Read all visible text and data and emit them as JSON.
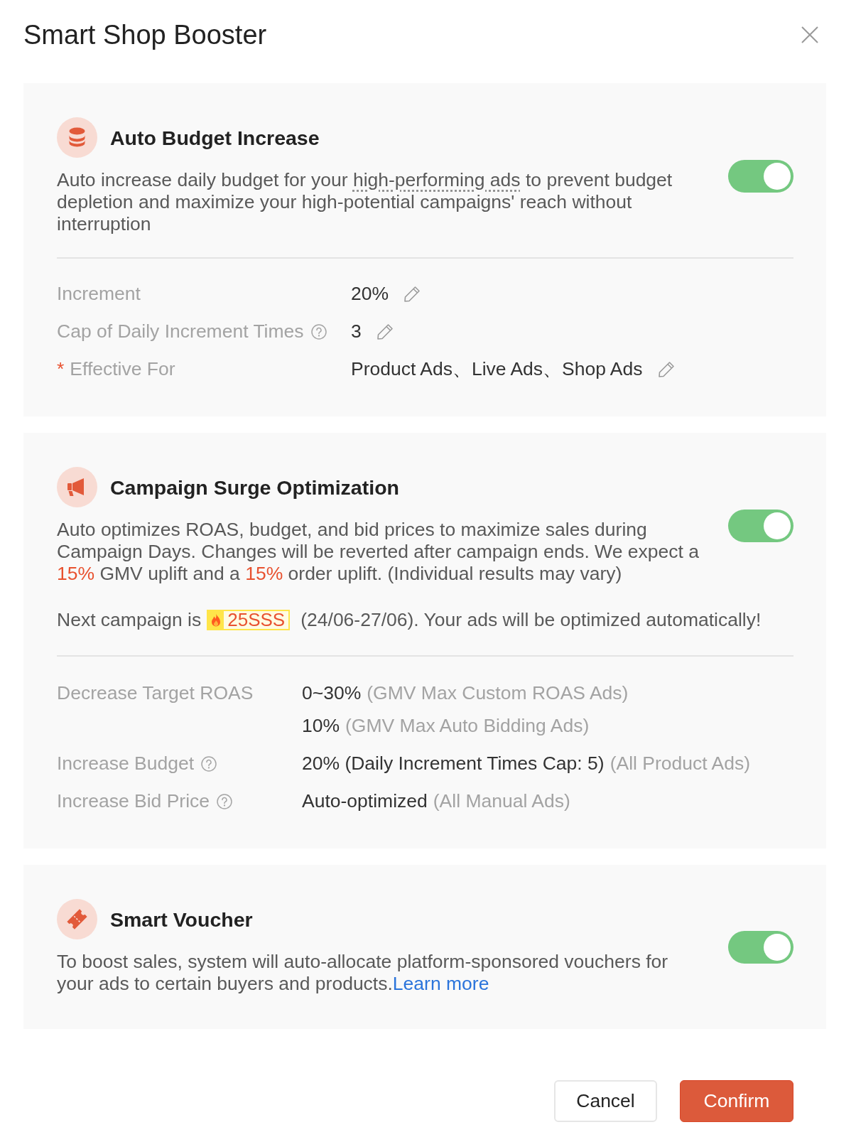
{
  "dialog": {
    "title": "Smart Shop Booster"
  },
  "sections": [
    {
      "title": "Auto Budget Increase",
      "enabled": true,
      "description": [
        {
          "kind": "text",
          "text": "Auto increase daily budget for your "
        },
        {
          "kind": "term",
          "text": "high-performing ads"
        },
        {
          "kind": "text",
          "text": " to prevent budget depletion and maximize your high-potential campaigns' reach without interruption"
        }
      ],
      "settings": [
        {
          "label": "Increment",
          "help": false,
          "editable": true,
          "values": [
            {
              "value": "20%"
            }
          ]
        },
        {
          "label": "Cap of Daily Increment Times",
          "help": true,
          "editable": true,
          "values": [
            {
              "value": "3"
            }
          ]
        },
        {
          "marker": "*",
          "label": "Effective For",
          "help": false,
          "editable": true,
          "values": [
            {
              "value": "Product Ads、Live Ads、Shop Ads"
            }
          ]
        }
      ]
    },
    {
      "title": "Campaign Surge Optimization",
      "enabled": true,
      "description": [
        {
          "kind": "text",
          "text": "Auto optimizes ROAS, budget, and bid prices to maximize sales during Campaign Days. Changes will be reverted after campaign ends. We expect a "
        },
        {
          "kind": "highlight",
          "text": "15%"
        },
        {
          "kind": "text",
          "text": " GMV uplift and a "
        },
        {
          "kind": "highlight",
          "text": "15%"
        },
        {
          "kind": "text",
          "text": " order uplift. (Individual results may vary)"
        }
      ],
      "campaign": {
        "lead": "Next campaign is",
        "name": "25SSS",
        "detail": "(24/06-27/06). Your ads will be optimized automatically!"
      },
      "settings": [
        {
          "label": "Decrease Target ROAS",
          "help": false,
          "editable": false,
          "values": [
            {
              "value": "0~30%",
              "note": "(GMV Max Custom ROAS Ads)"
            },
            {
              "value": "10%",
              "note": "(GMV Max Auto Bidding Ads)"
            }
          ]
        },
        {
          "label": "Increase Budget",
          "help": true,
          "editable": false,
          "values": [
            {
              "value": "20% (Daily Increment Times Cap: 5)",
              "note": "(All Product Ads)"
            }
          ]
        },
        {
          "label": "Increase Bid Price",
          "help": true,
          "editable": false,
          "values": [
            {
              "value": "Auto-optimized",
              "note": "(All Manual Ads)"
            }
          ]
        }
      ]
    },
    {
      "title": "Smart Voucher",
      "enabled": true,
      "description": [
        {
          "kind": "text",
          "text": "To boost sales, system will auto-allocate platform-sponsored vouchers for your ads to certain buyers and products."
        },
        {
          "kind": "link",
          "text": "Learn more"
        }
      ]
    }
  ],
  "buttons": [
    {
      "label": "Cancel",
      "kind": "secondary"
    },
    {
      "label": "Confirm",
      "kind": "primary"
    }
  ]
}
